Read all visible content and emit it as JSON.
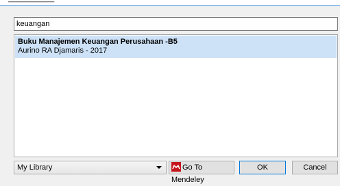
{
  "search": {
    "value": "keuangan"
  },
  "results": [
    {
      "title": "Buku Manajemen Keuangan Perusahaan -B5",
      "subtitle": "Aurino RA Djamaris - 2017"
    }
  ],
  "footer": {
    "library_select": "My Library",
    "mendeley_button": "Go To Mendeley",
    "ok_button": "OK",
    "cancel_button": "Cancel"
  },
  "colors": {
    "selection": "#cde2f7",
    "focus_border": "#0078d7",
    "mendeley_red": "#c4161c"
  },
  "icons": {
    "mendeley": "mendeley-logo-icon",
    "dropdown": "chevron-down-icon"
  }
}
